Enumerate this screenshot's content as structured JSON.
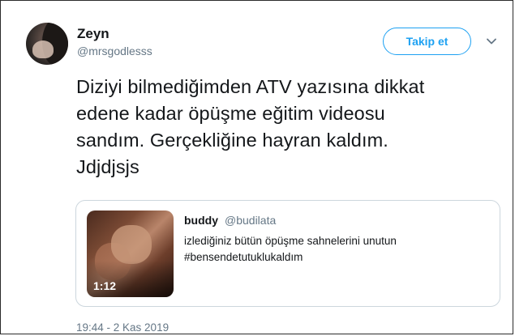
{
  "author": {
    "display_name": "Zeyn",
    "handle": "@mrsgodlesss"
  },
  "follow_button": {
    "label": "Takip et"
  },
  "tweet": {
    "lines": [
      "Diziyi bilmediğimden ATV yazısına dikkat",
      "edene kadar öpüşme eğitim videosu",
      "sandım. Gerçekliğine hayran kaldım.",
      "Jdjdjsjs"
    ],
    "timestamp": "19:44 - 2 Kas 2019"
  },
  "quoted_tweet": {
    "display_name": "buddy",
    "handle": "@budilata",
    "lines": [
      "izlediğiniz bütün öpüşme sahnelerini unutun",
      "#bensendetutuklukaldım"
    ],
    "video_duration": "1:12"
  },
  "colors": {
    "accent": "#1da1f2",
    "secondary_text": "#657786",
    "primary_text": "#14171a",
    "card_border": "#ccd6dd"
  },
  "icons": {
    "menu": "chevron-down-icon"
  }
}
